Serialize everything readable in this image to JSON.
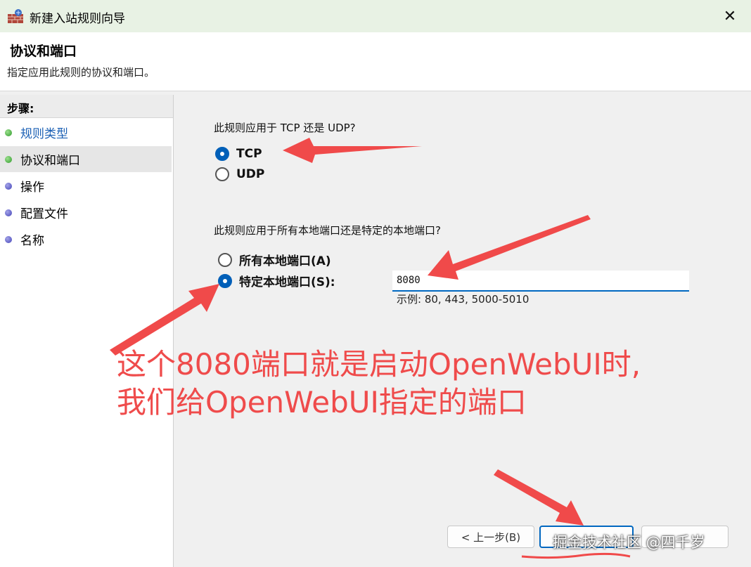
{
  "window": {
    "title": "新建入站规则向导",
    "close_glyph": "✕"
  },
  "header": {
    "title": "协议和端口",
    "subtitle": "指定应用此规则的协议和端口。"
  },
  "steps": {
    "header": "步骤:",
    "items": [
      {
        "label": "规则类型",
        "dot": "green",
        "state": "link"
      },
      {
        "label": "协议和端口",
        "dot": "green",
        "state": "current"
      },
      {
        "label": "操作",
        "dot": "purple",
        "state": "pending"
      },
      {
        "label": "配置文件",
        "dot": "purple",
        "state": "pending"
      },
      {
        "label": "名称",
        "dot": "purple",
        "state": "pending"
      }
    ]
  },
  "protocol": {
    "question": "此规则应用于 TCP 还是 UDP?",
    "options": [
      {
        "label": "TCP",
        "checked": true
      },
      {
        "label": "UDP",
        "checked": false
      }
    ]
  },
  "ports": {
    "question": "此规则应用于所有本地端口还是特定的本地端口?",
    "options": [
      {
        "label": "所有本地端口(A)",
        "checked": false
      },
      {
        "label": "特定本地端口(S):",
        "checked": true
      }
    ],
    "value": "8080",
    "example": "示例: 80, 443, 5000-5010"
  },
  "annotation": {
    "line1": "这个8080端口就是启动OpenWebUI时,",
    "line2": "我们给OpenWebUI指定的端口"
  },
  "buttons": {
    "back": "< 上一步(B)"
  },
  "watermark": "掘金技术社区 @四千岁",
  "colors": {
    "annotation": "#ef4b4b",
    "accent": "#005fb8",
    "titlebar": "#e8f2e4"
  }
}
